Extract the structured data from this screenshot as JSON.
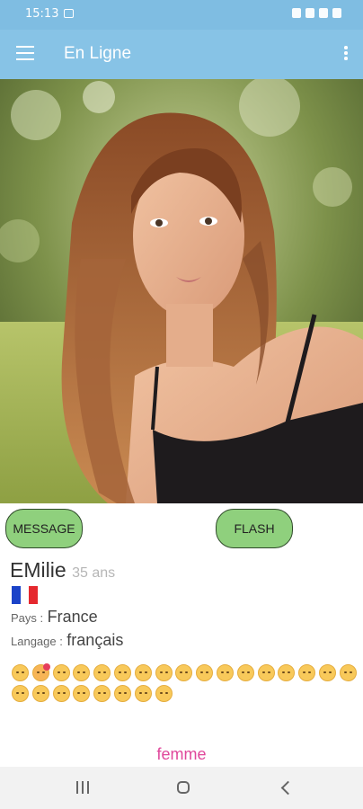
{
  "status_bar": {
    "time": "15:13"
  },
  "app_bar": {
    "title": "En Ligne"
  },
  "profile": {
    "name": "EMilie",
    "age": "35 ans",
    "country_label": "Pays :",
    "country": "France",
    "language_label": "Langage :",
    "language": "français",
    "gender": "femme",
    "flag_colors": [
      "#1b43c8",
      "#ffffff",
      "#e5282e"
    ]
  },
  "actions": {
    "message_label": "MESSAGE",
    "flash_label": "FLASH"
  },
  "emojis": [
    "smirk",
    "heart-eyes",
    "smirk",
    "unamused",
    "smirk",
    "smirk",
    "smirk",
    "smirk",
    "smirk",
    "unamused",
    "unamused",
    "smirk",
    "relieved",
    "smile",
    "relieved",
    "smirk",
    "relieved",
    "unamused",
    "relieved",
    "unamused",
    "smile",
    "smile",
    "smile",
    "smile",
    "relieved"
  ],
  "nav": {
    "recents_icon": "recents-icon",
    "home_icon": "home-icon",
    "back_icon": "back-icon"
  },
  "colors": {
    "app_bar": "#87c3e6",
    "status_bar": "#7fbde2",
    "button": "#8fd07d",
    "gender": "#e0479b"
  }
}
